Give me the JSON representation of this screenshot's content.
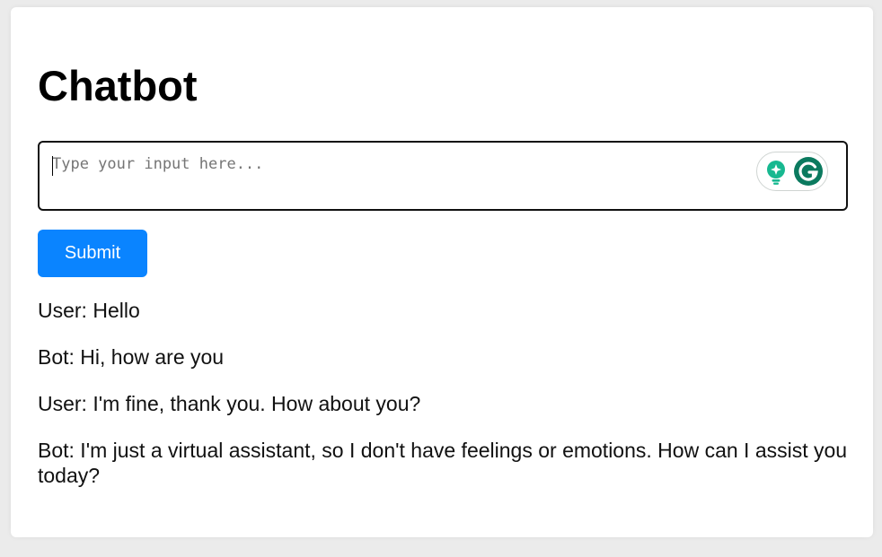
{
  "page": {
    "title": "Chatbot"
  },
  "input": {
    "placeholder": "Type your input here...",
    "value": ""
  },
  "extension": {
    "icons": [
      "lightbulb-icon",
      "grammarly-icon"
    ],
    "colors": {
      "bulb": "#17b890",
      "logo": "#0b7a5f"
    }
  },
  "submit": {
    "label": "Submit",
    "color": "#0a84ff"
  },
  "messages": [
    "User: Hello",
    "Bot: Hi, how are you",
    "User: I'm fine, thank you. How about you?",
    "Bot: I'm just a virtual assistant, so I don't have feelings or emotions. How can I assist you today?"
  ]
}
